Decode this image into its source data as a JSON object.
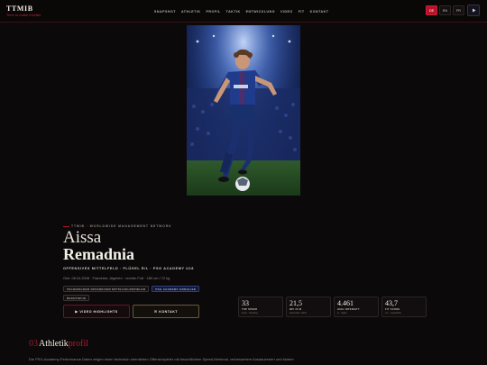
{
  "brand": {
    "title": "TTMIB",
    "subtitle": "Time to make it better"
  },
  "nav": [
    "SNAPSHOT",
    "ATHLETIK",
    "PROFIL",
    "TAKTIK",
    "ENTWICKLUNG",
    "VIDEO",
    "FIT",
    "KONTAKT"
  ],
  "languages": [
    {
      "label": "DE",
      "active": true
    },
    {
      "label": "EN",
      "active": false
    },
    {
      "label": "FR",
      "active": false
    }
  ],
  "eyebrow": "TTMIB · WORLDWIDE MANAGEMENT NETWORK",
  "player": {
    "first_name": "Aissa",
    "last_name": "Remadnia",
    "position": "OFFENSIVES MITTELFELD · FLÜGEL R/L · PSG ACADEMY U18",
    "details": "Geb. 08.04.2008 · Franchise, Algerien · rechter Fuß · 180 cm / 72 kg"
  },
  "chips": [
    {
      "label": "TECHNISCHER OFFENSIVER MITTELFELDSPIELER",
      "style": "default"
    },
    {
      "label": "PSG ACADEMY ERDGLIED",
      "style": "blue"
    },
    {
      "label": "RECHTSFUß",
      "style": "default"
    }
  ],
  "buttons": {
    "video": "VIDEO HIGHLIGHTS",
    "contact": "KONTAKT"
  },
  "stats": [
    {
      "value": "33",
      "label": "TOP SPEED",
      "note": "km/h · Tracking"
    },
    {
      "value": "21,5",
      "label": "BPI 30 M",
      "note": "Sprintzeit / GPS"
    },
    {
      "value": "4.461",
      "label": "HIGH INTENSITY",
      "note": "m · Spiel"
    },
    {
      "value": "43,7",
      "label": "FIT SCORE",
      "note": "cm · Jumphöhe"
    }
  ],
  "profile_section": {
    "number": "03",
    "title_a": "Athletik",
    "title_b": "profil",
    "text": "Die PSG-Academy-Performance-Daten zeigen einen technisch orientierten Offensivspieler mit beachtlichem Speed-Merkmal, verbessertem Ausdauerwert und klarem"
  },
  "colors": {
    "accent": "#b4152b",
    "background": "#0c090a"
  }
}
